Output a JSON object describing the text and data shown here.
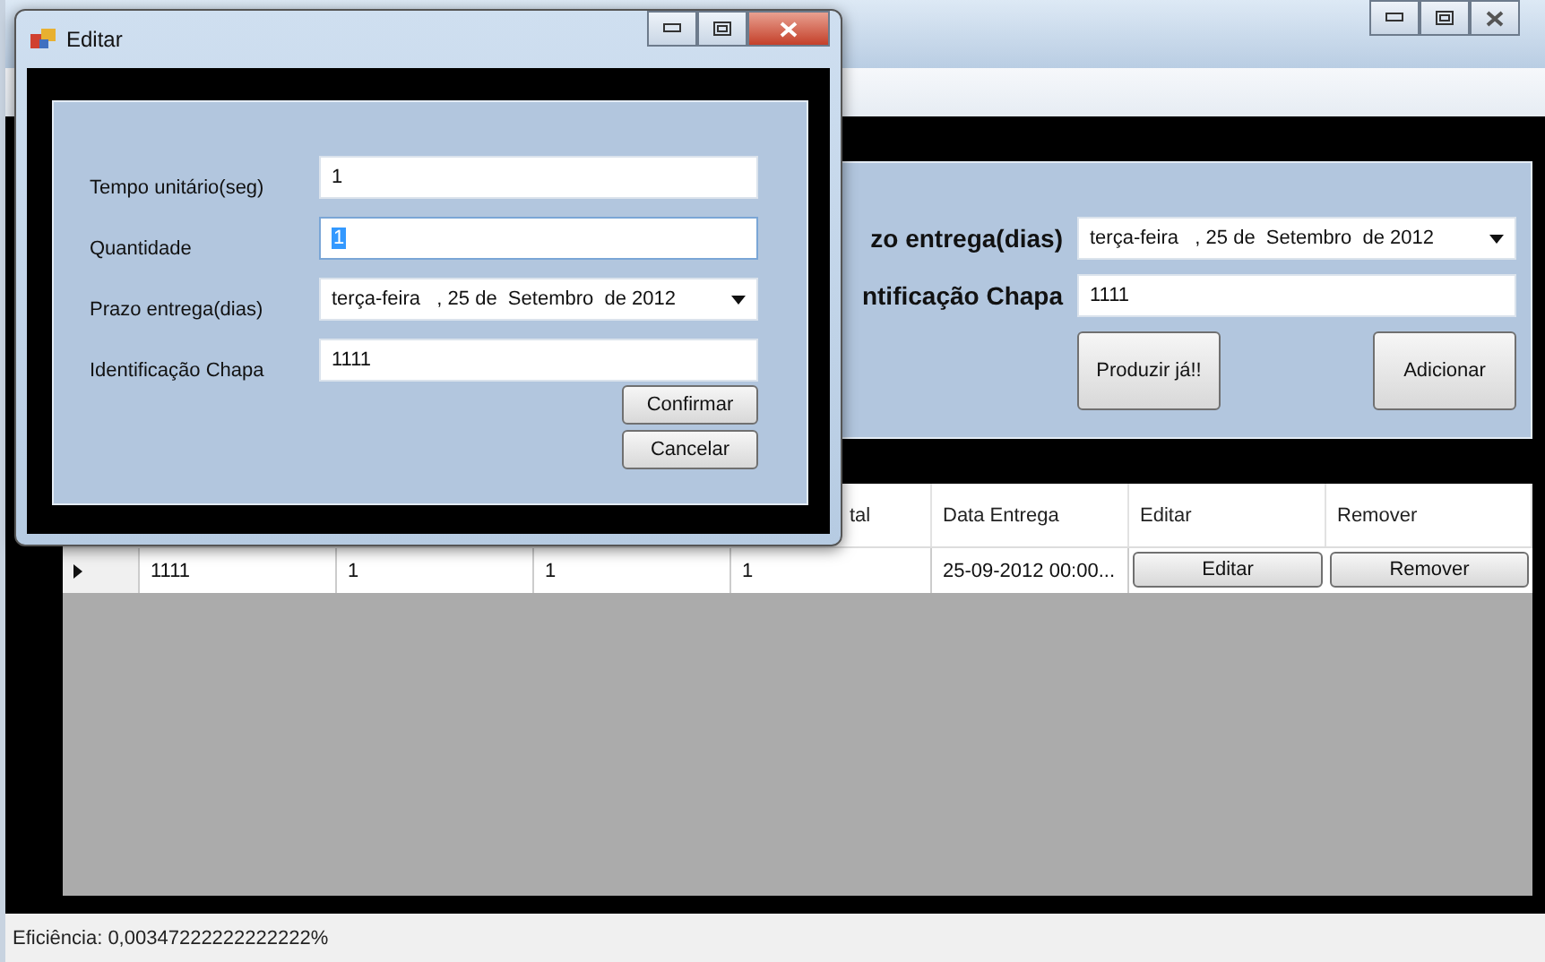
{
  "main_window": {
    "panel": {
      "fields": [
        {
          "label": "zo entrega(dias)",
          "kind": "date",
          "value": "terça-feira   , 25 de  Setembro  de 2012"
        },
        {
          "label": "ntificação Chapa",
          "kind": "text",
          "value": "1111"
        }
      ],
      "buttons": [
        "Produzir já!!",
        "Adicionar"
      ]
    },
    "grid": {
      "columns": [
        {},
        {},
        {},
        {
          "label": "tal"
        },
        {
          "label": "Data Entrega"
        },
        {
          "label": "Editar"
        },
        {
          "label": "Remover"
        }
      ],
      "rows": [
        {
          "current": true,
          "cells": [
            {
              "kind": "text",
              "text": "1111"
            },
            {
              "kind": "text",
              "text": "1"
            },
            {
              "kind": "text",
              "text": "1"
            },
            {
              "kind": "text",
              "text": "1"
            },
            {
              "kind": "text",
              "text": "25-09-2012 00:00..."
            },
            {
              "kind": "button",
              "text": "Editar"
            },
            {
              "kind": "button",
              "text": "Remover"
            }
          ]
        }
      ]
    },
    "status_bar": "Eficiência: 0,00347222222222222%"
  },
  "dialog": {
    "title": "Editar",
    "fields": [
      {
        "label": "Tempo unitário(seg)",
        "kind": "text",
        "value": "1",
        "selected": false
      },
      {
        "label": "Quantidade",
        "kind": "text",
        "value": "1",
        "selected": true
      },
      {
        "label": "Prazo entrega(dias)",
        "kind": "date",
        "value": "terça-feira   , 25 de  Setembro  de 2012"
      },
      {
        "label": "Identificação Chapa",
        "kind": "text",
        "value": "1111",
        "selected": false
      }
    ],
    "buttons": [
      "Confirmar",
      "Cancelar"
    ]
  }
}
